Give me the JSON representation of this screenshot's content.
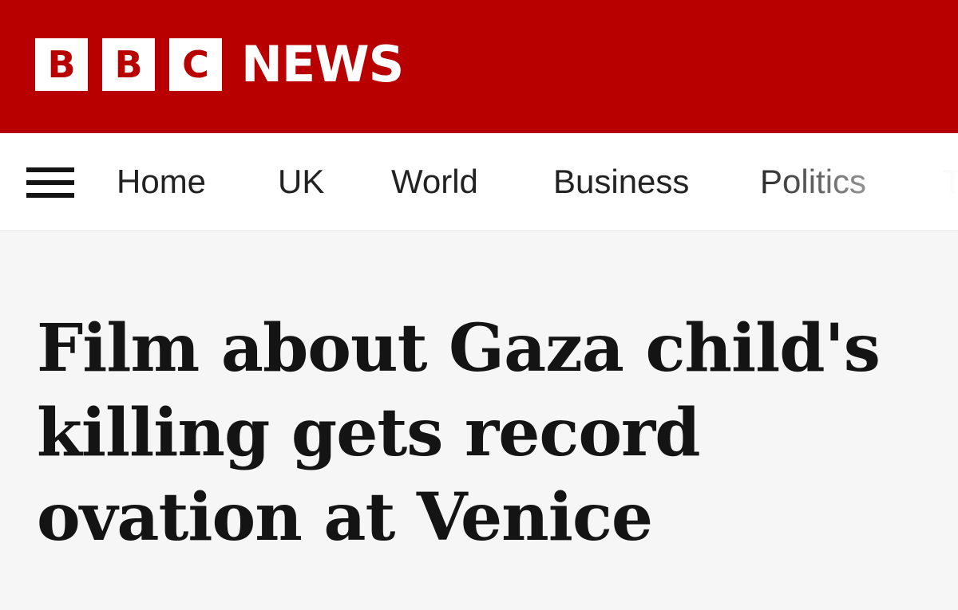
{
  "brand": {
    "logo_letters": [
      "B",
      "B",
      "C"
    ],
    "logo_word": "NEWS",
    "colors": {
      "masthead": "#b80000",
      "nav_background": "#ffffff",
      "page_background": "#f6f6f6",
      "text": "#141414"
    }
  },
  "nav": {
    "menu_icon": "hamburger-menu-icon",
    "items": [
      {
        "label": "Home"
      },
      {
        "label": "UK"
      },
      {
        "label": "World"
      },
      {
        "label": "Business"
      },
      {
        "label": "Politics"
      },
      {
        "label": "T"
      }
    ]
  },
  "article": {
    "headline": "Film about Gaza child's killing gets record ovation at Venice"
  }
}
